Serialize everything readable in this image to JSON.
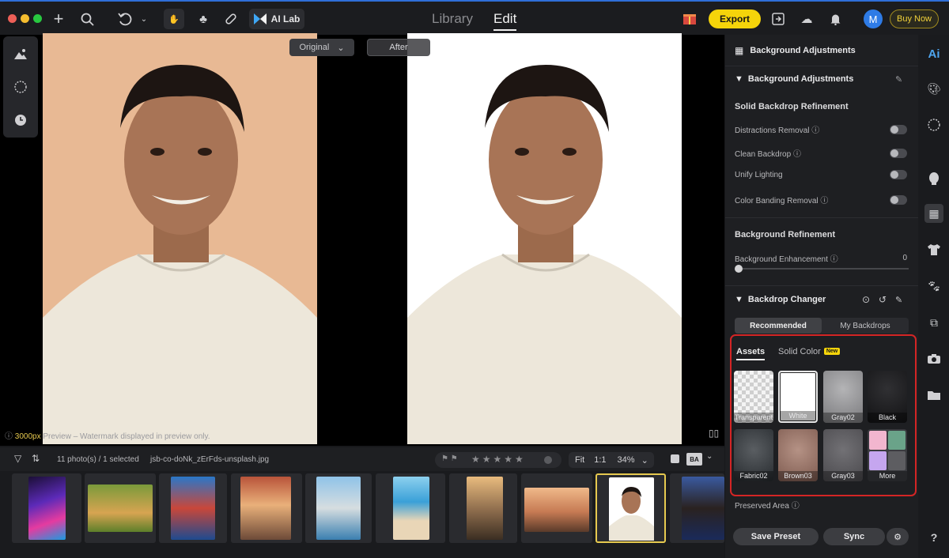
{
  "toolbar": {
    "ai_lab_label": "AI Lab",
    "export_label": "Export",
    "avatar_initial": "M",
    "buy_now_label": "Buy Now",
    "modes": [
      "Library",
      "Edit"
    ],
    "active_mode": "Edit"
  },
  "canvas": {
    "original_select": "Original",
    "after_label": "After",
    "preview_px": "3000px",
    "preview_note": "Preview – Watermark displayed in preview only."
  },
  "filmstrip": {
    "count_label": "11 photo(s) / 1 selected",
    "filename": "jsb-co-doNk_zErFds-unsplash.jpg",
    "fit_label": "Fit",
    "ratio_label": "1:1",
    "zoom_label": "34%",
    "ba_label": "BA"
  },
  "panel": {
    "header": "Background Adjustments",
    "section_title": "Background Adjustments",
    "solid_title": "Solid Backdrop Refinement",
    "options": [
      {
        "label": "Distractions Removal",
        "info": true
      },
      {
        "label": "Clean Backdrop",
        "info": true
      },
      {
        "label": "Unify Lighting",
        "info": false
      },
      {
        "label": "Color Banding Removal",
        "info": true
      }
    ],
    "refinement_title": "Background Refinement",
    "enhancement_label": "Background Enhancement",
    "enhancement_value": "0",
    "changer_title": "Backdrop Changer",
    "seg_tabs": [
      "Recommended",
      "My Backdrops"
    ],
    "asset_tabs": [
      "Assets",
      "Solid Color"
    ],
    "new_badge": "New",
    "swatches": [
      {
        "name": "Transparent",
        "color": "#e9e9e9"
      },
      {
        "name": "White",
        "color": "#ffffff"
      },
      {
        "name": "Gray02",
        "color": "#8d8d90"
      },
      {
        "name": "Black",
        "color": "#1c1c1e"
      },
      {
        "name": "Fabric02",
        "color": "#35393d"
      },
      {
        "name": "Brown03",
        "color": "#9c7668"
      },
      {
        "name": "Gray03",
        "color": "#5d5c60"
      },
      {
        "name": "More",
        "color": "#d9a7c2"
      }
    ],
    "preserved_label": "Preserved Area",
    "save_preset_label": "Save Preset",
    "sync_label": "Sync"
  },
  "icons": [
    "plus-icon",
    "search-icon",
    "undo-icon",
    "hand-icon",
    "tree-icon",
    "bandage-icon",
    "gift-icon",
    "share-icon",
    "cloud-icon",
    "bell-icon",
    "ai-icon",
    "palette-icon",
    "face-icon",
    "shirt-icon",
    "paw-icon",
    "crop-icon",
    "camera-icon",
    "folder-icon",
    "help-icon"
  ]
}
